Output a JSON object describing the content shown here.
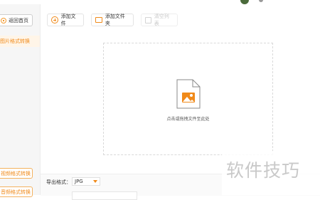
{
  "sidebar": {
    "back_label": "返回首页",
    "active_item": "图片格式转换",
    "bottom_items": [
      "视频格式转换",
      "音频格式转换"
    ]
  },
  "toolbar": {
    "add_file": "添加文件",
    "add_folder": "添加文件夹",
    "clear_list": "清空列表"
  },
  "dropzone": {
    "hint": "点击或拖拽文件至此处"
  },
  "bottom": {
    "export_format_label": "导出格式：",
    "format_value": "JPG"
  },
  "watermark": "软件技巧",
  "colors": {
    "accent": "#f08a1a",
    "sidebar_bg": "#f6f6f6"
  }
}
